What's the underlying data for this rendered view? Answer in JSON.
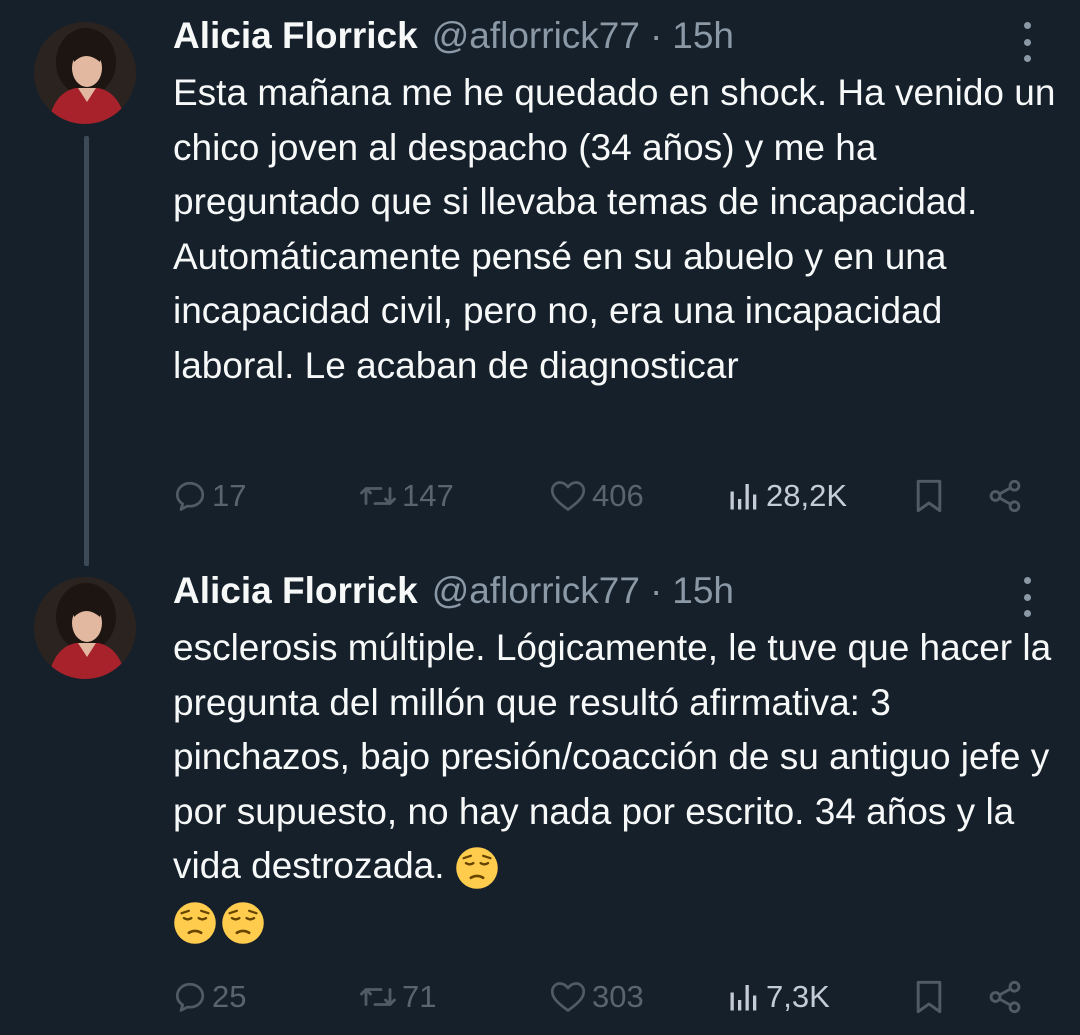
{
  "tweets": [
    {
      "author": "Alicia Florrick",
      "handle": "@aflorrick77",
      "separator": "·",
      "time": "15h",
      "text": "Esta mañana me he quedado en shock. Ha venido un chico joven al despacho (34 años) y me ha preguntado que si llevaba temas de incapacidad. Automáticamente pensé en su abuelo y en una incapacidad civil, pero no, era una incapacidad laboral. Le acaban de diagnosticar",
      "replies": "17",
      "retweets": "147",
      "likes": "406",
      "views": "28,2K"
    },
    {
      "author": "Alicia Florrick",
      "handle": "@aflorrick77",
      "separator": "·",
      "time": "15h",
      "text": "esclerosis múltiple. Lógicamente, le tuve que hacer la pregunta del millón que resultó afirmativa: 3 pinchazos, bajo presión/coacción de su antiguo jefe y por supuesto, no hay nada por escrito. 34 años y la vida destrozada.",
      "replies": "25",
      "retweets": "71",
      "likes": "303",
      "views": "7,3K"
    }
  ],
  "icons": [
    "reply-icon",
    "retweet-icon",
    "like-icon",
    "views-icon",
    "bookmark-icon",
    "share-icon",
    "more-icon",
    "pensive-face-emoji"
  ],
  "colors": {
    "background": "#15202b",
    "text": "#f7f9f9",
    "muted": "#8b98a5",
    "action": "#505b66"
  }
}
